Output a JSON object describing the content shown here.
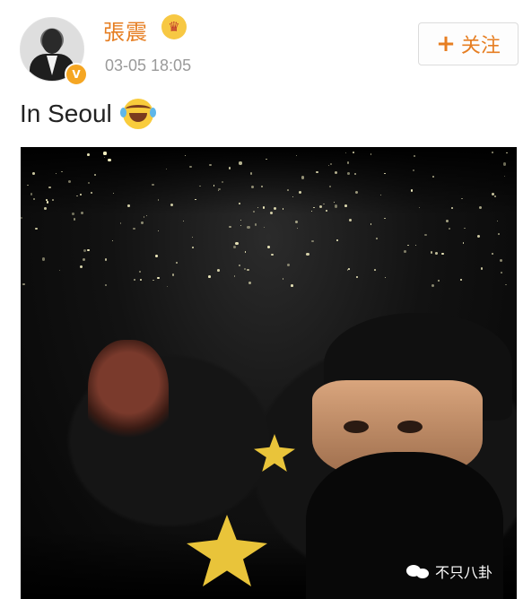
{
  "post": {
    "username": "張震",
    "timestamp": "03-05 18:05",
    "follow_label": "关注",
    "follow_icon": "plus-icon",
    "verified_icon": "verified-v-badge",
    "username_badge_icon": "crown-icon",
    "text": "In Seoul",
    "text_emoji": "laughing-crying-emoji"
  },
  "photo": {
    "subject": "concert-selfie-photo"
  },
  "watermark": {
    "icon": "wechat-icon",
    "text": "不只八卦"
  },
  "colors": {
    "accent": "#e67e22",
    "timestamp_gray": "#9a9a9a",
    "badge_orange": "#f5a623"
  }
}
